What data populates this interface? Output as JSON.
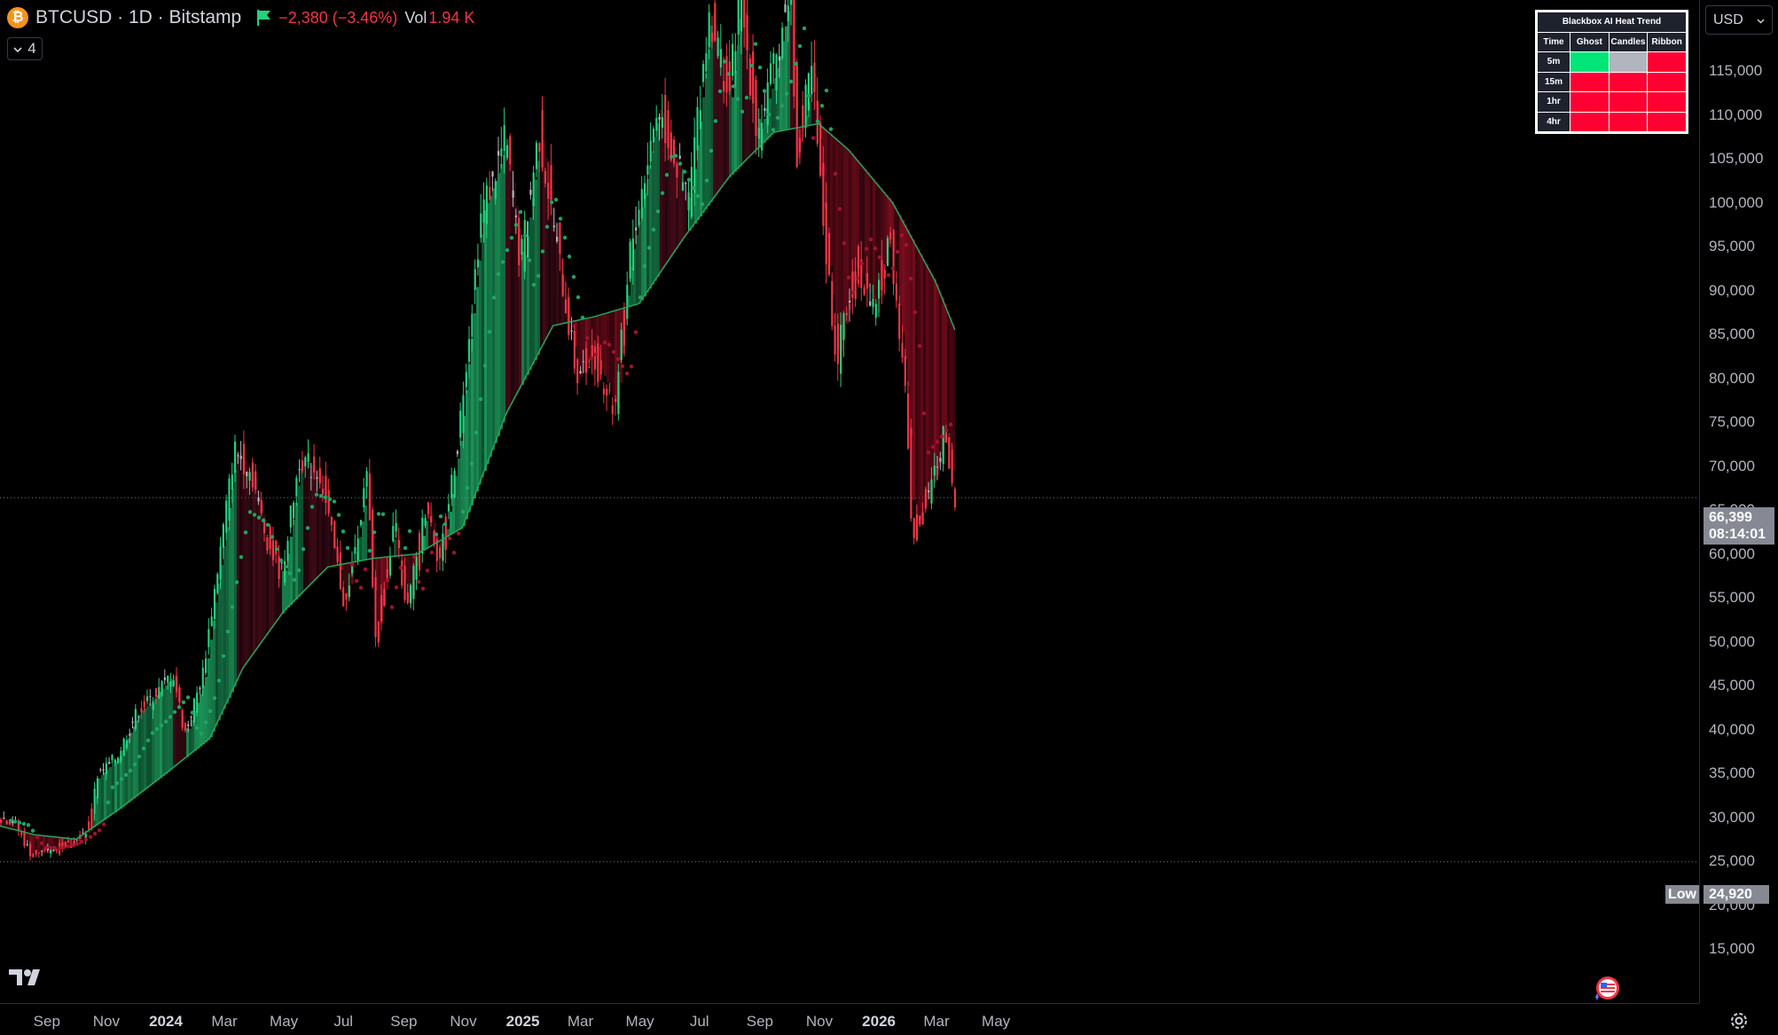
{
  "header": {
    "coin_glyph": "₿",
    "symbol": "BTCUSD · 1D · Bitstamp",
    "change": "−2,380 (−3.46%)",
    "vol_label": "Vol",
    "vol_value": "1.94 K",
    "indicator_count": "4"
  },
  "currency_button": {
    "label": "USD"
  },
  "heat_table": {
    "title": "Blackbox AI Heat Trend",
    "headers": [
      "Time",
      "Ghost",
      "Candles",
      "Ribbon"
    ],
    "rows": [
      {
        "label": "5m",
        "cells": [
          "green",
          "gray",
          "red"
        ]
      },
      {
        "label": "15m",
        "cells": [
          "red",
          "red",
          "red"
        ]
      },
      {
        "label": "1hr",
        "cells": [
          "red",
          "red",
          "red"
        ]
      },
      {
        "label": "4hr",
        "cells": [
          "red",
          "red",
          "red"
        ]
      }
    ],
    "colors": {
      "green": "#00e676",
      "gray": "#b2b5be",
      "red": "#ff0033"
    }
  },
  "price_tags": {
    "last_price": "66,399",
    "countdown": "08:14:01",
    "low_label": "Low",
    "low_value": "24,920"
  },
  "colors": {
    "up": "#26d07c",
    "down": "#f23645",
    "neutral": "#b2b5be",
    "ma": "#26a65b",
    "bg": "#000000"
  },
  "chart_data": {
    "type": "line",
    "title": "",
    "xlabel": "",
    "ylabel": "",
    "y_ticks": [
      "15,000",
      "20,000",
      "25,000",
      "30,000",
      "35,000",
      "40,000",
      "45,000",
      "50,000",
      "55,000",
      "60,000",
      "65,000",
      "70,000",
      "75,000",
      "80,000",
      "85,000",
      "90,000",
      "95,000",
      "100,000",
      "105,000",
      "110,000",
      "115,000"
    ],
    "ylim": [
      12000,
      120000
    ],
    "x_ticks": [
      {
        "label": "Sep",
        "bold": false
      },
      {
        "label": "Nov",
        "bold": false
      },
      {
        "label": "2024",
        "bold": true
      },
      {
        "label": "Mar",
        "bold": false
      },
      {
        "label": "May",
        "bold": false
      },
      {
        "label": "Jul",
        "bold": false
      },
      {
        "label": "Sep",
        "bold": false
      },
      {
        "label": "Nov",
        "bold": false
      },
      {
        "label": "2025",
        "bold": true
      },
      {
        "label": "Mar",
        "bold": false
      },
      {
        "label": "May",
        "bold": false
      },
      {
        "label": "Jul",
        "bold": false
      },
      {
        "label": "Sep",
        "bold": false
      },
      {
        "label": "Nov",
        "bold": false
      },
      {
        "label": "2026",
        "bold": true
      },
      {
        "label": "Mar",
        "bold": false
      },
      {
        "label": "May",
        "bold": false
      }
    ],
    "x_start": "2023-07-15",
    "series": [
      {
        "name": "Price",
        "points": [
          [
            "2023-07-15",
            30000
          ],
          [
            "2023-08-01",
            29500
          ],
          [
            "2023-08-17",
            26000
          ],
          [
            "2023-09-01",
            25900
          ],
          [
            "2023-09-15",
            26500
          ],
          [
            "2023-10-01",
            27200
          ],
          [
            "2023-10-16",
            28500
          ],
          [
            "2023-10-24",
            34500
          ],
          [
            "2023-11-15",
            37000
          ],
          [
            "2023-12-05",
            42000
          ],
          [
            "2023-12-20",
            43500
          ],
          [
            "2024-01-11",
            46500
          ],
          [
            "2024-01-23",
            39500
          ],
          [
            "2024-02-10",
            46000
          ],
          [
            "2024-02-28",
            60000
          ],
          [
            "2024-03-14",
            72000
          ],
          [
            "2024-04-01",
            69000
          ],
          [
            "2024-04-15",
            62000
          ],
          [
            "2024-05-01",
            57500
          ],
          [
            "2024-05-20",
            71000
          ],
          [
            "2024-06-10",
            69000
          ],
          [
            "2024-07-05",
            54000
          ],
          [
            "2024-07-28",
            69000
          ],
          [
            "2024-08-05",
            50000
          ],
          [
            "2024-08-25",
            64000
          ],
          [
            "2024-09-06",
            53000
          ],
          [
            "2024-09-27",
            66000
          ],
          [
            "2024-10-10",
            59000
          ],
          [
            "2024-10-29",
            73000
          ],
          [
            "2024-11-12",
            88000
          ],
          [
            "2024-11-22",
            99000
          ],
          [
            "2024-12-05",
            103000
          ],
          [
            "2024-12-17",
            107500
          ],
          [
            "2025-01-01",
            93000
          ],
          [
            "2025-01-20",
            108000
          ],
          [
            "2025-02-05",
            97000
          ],
          [
            "2025-02-28",
            80000
          ],
          [
            "2025-03-15",
            83000
          ],
          [
            "2025-04-08",
            76500
          ],
          [
            "2025-04-22",
            93500
          ],
          [
            "2025-05-22",
            111000
          ],
          [
            "2025-06-22",
            100000
          ],
          [
            "2025-07-14",
            122000
          ],
          [
            "2025-08-03",
            112000
          ],
          [
            "2025-08-14",
            124000
          ],
          [
            "2025-09-01",
            108000
          ],
          [
            "2025-09-20",
            116000
          ],
          [
            "2025-10-06",
            126000
          ],
          [
            "2025-10-10",
            105000
          ],
          [
            "2025-10-27",
            115000
          ],
          [
            "2025-11-05",
            101000
          ],
          [
            "2025-11-21",
            82000
          ],
          [
            "2025-12-10",
            93000
          ],
          [
            "2025-12-31",
            87500
          ],
          [
            "2026-01-14",
            97000
          ],
          [
            "2026-01-31",
            78000
          ],
          [
            "2026-02-06",
            62000
          ],
          [
            "2026-02-20",
            66000
          ],
          [
            "2026-03-04",
            70000
          ],
          [
            "2026-03-12",
            74000
          ],
          [
            "2026-03-16",
            71000
          ],
          [
            "2026-03-20",
            66399
          ]
        ]
      },
      {
        "name": "MA",
        "points": [
          [
            "2023-07-15",
            29000
          ],
          [
            "2023-08-20",
            28000
          ],
          [
            "2023-10-01",
            27500
          ],
          [
            "2023-11-15",
            31000
          ],
          [
            "2024-01-01",
            35000
          ],
          [
            "2024-02-15",
            39000
          ],
          [
            "2024-03-20",
            47000
          ],
          [
            "2024-05-01",
            53500
          ],
          [
            "2024-06-15",
            58500
          ],
          [
            "2024-08-01",
            59500
          ],
          [
            "2024-09-15",
            60000
          ],
          [
            "2024-10-31",
            63000
          ],
          [
            "2024-12-15",
            76000
          ],
          [
            "2025-02-01",
            86000
          ],
          [
            "2025-03-15",
            87000
          ],
          [
            "2025-04-30",
            88500
          ],
          [
            "2025-06-15",
            96000
          ],
          [
            "2025-08-01",
            103000
          ],
          [
            "2025-09-15",
            108000
          ],
          [
            "2025-10-31",
            109000
          ],
          [
            "2025-12-01",
            106000
          ],
          [
            "2026-01-15",
            100000
          ],
          [
            "2026-02-28",
            91000
          ],
          [
            "2026-03-20",
            85500
          ]
        ]
      }
    ]
  }
}
